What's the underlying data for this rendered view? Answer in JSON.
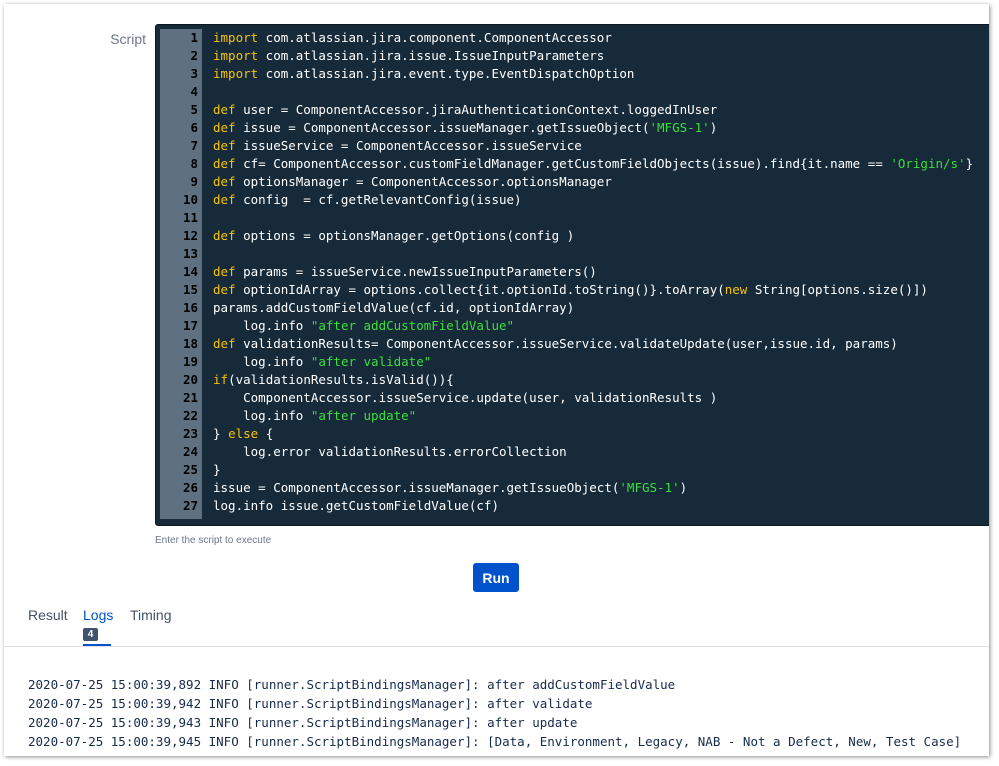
{
  "editor": {
    "label": "Script",
    "hint": "Enter the script to execute",
    "lines": [
      [
        {
          "t": "kw",
          "v": "import"
        },
        {
          "t": "p",
          "v": " com.atlassian.jira.component.ComponentAccessor"
        }
      ],
      [
        {
          "t": "kw",
          "v": "import"
        },
        {
          "t": "p",
          "v": " com.atlassian.jira.issue.IssueInputParameters"
        }
      ],
      [
        {
          "t": "kw",
          "v": "import"
        },
        {
          "t": "p",
          "v": " com.atlassian.jira.event.type.EventDispatchOption"
        }
      ],
      [],
      [
        {
          "t": "kw",
          "v": "def"
        },
        {
          "t": "p",
          "v": " user = ComponentAccessor.jiraAuthenticationContext.loggedInUser"
        }
      ],
      [
        {
          "t": "kw",
          "v": "def"
        },
        {
          "t": "p",
          "v": " issue = ComponentAccessor.issueManager.getIssueObject("
        },
        {
          "t": "str",
          "v": "'MFGS-1'"
        },
        {
          "t": "p",
          "v": ")"
        }
      ],
      [
        {
          "t": "kw",
          "v": "def"
        },
        {
          "t": "p",
          "v": " issueService = ComponentAccessor.issueService"
        }
      ],
      [
        {
          "t": "kw",
          "v": "def"
        },
        {
          "t": "p",
          "v": " cf= ComponentAccessor.customFieldManager.getCustomFieldObjects(issue).find{it.name == "
        },
        {
          "t": "str",
          "v": "'Origin/s'"
        },
        {
          "t": "p",
          "v": "}"
        }
      ],
      [
        {
          "t": "kw",
          "v": "def"
        },
        {
          "t": "p",
          "v": " optionsManager = ComponentAccessor.optionsManager"
        }
      ],
      [
        {
          "t": "kw",
          "v": "def"
        },
        {
          "t": "p",
          "v": " config  = cf.getRelevantConfig(issue)"
        }
      ],
      [],
      [
        {
          "t": "kw",
          "v": "def"
        },
        {
          "t": "p",
          "v": " options = optionsManager.getOptions(config )"
        }
      ],
      [],
      [
        {
          "t": "kw",
          "v": "def"
        },
        {
          "t": "p",
          "v": " params = issueService.newIssueInputParameters()"
        }
      ],
      [
        {
          "t": "kw",
          "v": "def"
        },
        {
          "t": "p",
          "v": " optionIdArray = options.collect{it.optionId.toString()}.toArray("
        },
        {
          "t": "kw",
          "v": "new"
        },
        {
          "t": "p",
          "v": " String[options.size()])"
        }
      ],
      [
        {
          "t": "p",
          "v": "params.addCustomFieldValue(cf.id, optionIdArray)"
        }
      ],
      [
        {
          "t": "p",
          "v": "    log.info "
        },
        {
          "t": "str",
          "v": "\"after addCustomFieldValue\""
        }
      ],
      [
        {
          "t": "kw",
          "v": "def"
        },
        {
          "t": "p",
          "v": " validationResults= ComponentAccessor.issueService.validateUpdate(user,issue.id, params)"
        }
      ],
      [
        {
          "t": "p",
          "v": "    log.info "
        },
        {
          "t": "str",
          "v": "\"after validate\""
        }
      ],
      [
        {
          "t": "kw",
          "v": "if"
        },
        {
          "t": "p",
          "v": "(validationResults.isValid()){"
        }
      ],
      [
        {
          "t": "p",
          "v": "    ComponentAccessor.issueService.update(user, validationResults )"
        }
      ],
      [
        {
          "t": "p",
          "v": "    log.info "
        },
        {
          "t": "str",
          "v": "\"after update\""
        }
      ],
      [
        {
          "t": "p",
          "v": "} "
        },
        {
          "t": "kw",
          "v": "else"
        },
        {
          "t": "p",
          "v": " {"
        }
      ],
      [
        {
          "t": "p",
          "v": "    log.error validationResults.errorCollection"
        }
      ],
      [
        {
          "t": "p",
          "v": "}"
        }
      ],
      [
        {
          "t": "p",
          "v": "issue = ComponentAccessor.issueManager.getIssueObject("
        },
        {
          "t": "str",
          "v": "'MFGS-1'"
        },
        {
          "t": "p",
          "v": ")"
        }
      ],
      [
        {
          "t": "p",
          "v": "log.info issue.getCustomFieldValue(cf)"
        }
      ]
    ]
  },
  "run_button": "Run",
  "tabs": [
    {
      "label": "Result",
      "active": false
    },
    {
      "label": "Logs",
      "active": true,
      "badge": "4"
    },
    {
      "label": "Timing",
      "active": false
    }
  ],
  "logs": [
    "2020-07-25 15:00:39,892 INFO [runner.ScriptBindingsManager]: after addCustomFieldValue",
    "2020-07-25 15:00:39,942 INFO [runner.ScriptBindingsManager]: after validate",
    "2020-07-25 15:00:39,943 INFO [runner.ScriptBindingsManager]: after update",
    "2020-07-25 15:00:39,945 INFO [runner.ScriptBindingsManager]: [Data, Environment, Legacy, NAB - Not a Defect, New, Test Case]"
  ],
  "colors": {
    "editor_bg": "#172a3a",
    "gutter_bg": "#5f7181",
    "keyword": "#f4c20d",
    "string": "#3adf3a",
    "accent": "#0052cc"
  }
}
